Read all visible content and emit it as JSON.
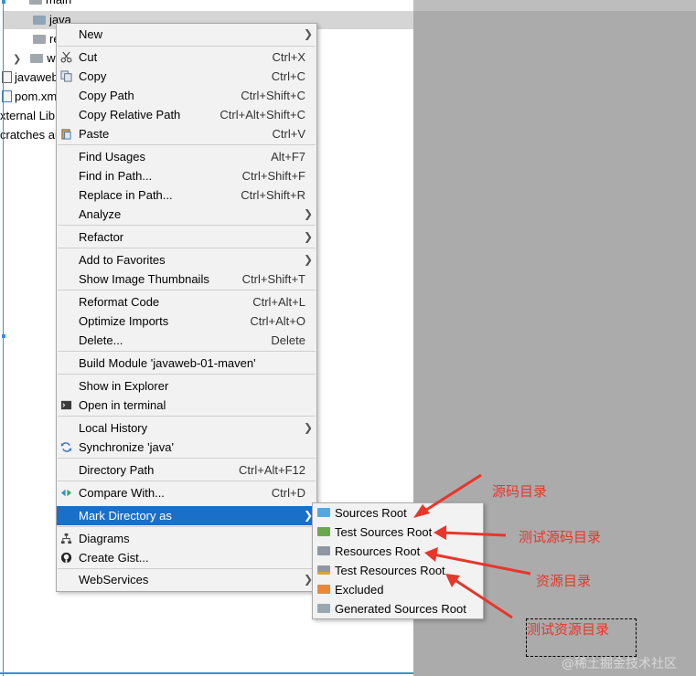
{
  "tree": {
    "main_label": "main",
    "java_label": "java",
    "res_label": "re",
    "w_label": "w",
    "javaweb_label": "javaweb",
    "pom_label": "pom.xm",
    "extlib_label": "xternal Lib",
    "scratches_label": "cratches ai"
  },
  "menu": {
    "new": {
      "label": "New"
    },
    "cut": {
      "label": "Cut",
      "shortcut": "Ctrl+X"
    },
    "copy": {
      "label": "Copy",
      "shortcut": "Ctrl+C"
    },
    "copy_path": {
      "label": "Copy Path",
      "shortcut": "Ctrl+Shift+C"
    },
    "copy_relative_path": {
      "label": "Copy Relative Path",
      "shortcut": "Ctrl+Alt+Shift+C"
    },
    "paste": {
      "label": "Paste",
      "shortcut": "Ctrl+V"
    },
    "find_usages": {
      "label": "Find Usages",
      "shortcut": "Alt+F7"
    },
    "find_in_path": {
      "label": "Find in Path...",
      "shortcut": "Ctrl+Shift+F"
    },
    "replace_in_path": {
      "label": "Replace in Path...",
      "shortcut": "Ctrl+Shift+R"
    },
    "analyze": {
      "label": "Analyze"
    },
    "refactor": {
      "label": "Refactor"
    },
    "add_to_favorites": {
      "label": "Add to Favorites"
    },
    "show_image_thumbnails": {
      "label": "Show Image Thumbnails",
      "shortcut": "Ctrl+Shift+T"
    },
    "reformat_code": {
      "label": "Reformat Code",
      "shortcut": "Ctrl+Alt+L"
    },
    "optimize_imports": {
      "label": "Optimize Imports",
      "shortcut": "Ctrl+Alt+O"
    },
    "delete": {
      "label": "Delete...",
      "shortcut": "Delete"
    },
    "build_module": {
      "label": "Build Module 'javaweb-01-maven'"
    },
    "show_in_explorer": {
      "label": "Show in Explorer"
    },
    "open_in_terminal": {
      "label": "Open in terminal"
    },
    "local_history": {
      "label": "Local History"
    },
    "synchronize": {
      "label": "Synchronize 'java'"
    },
    "directory_path": {
      "label": "Directory Path",
      "shortcut": "Ctrl+Alt+F12"
    },
    "compare_with": {
      "label": "Compare With...",
      "shortcut": "Ctrl+D"
    },
    "mark_directory_as": {
      "label": "Mark Directory as"
    },
    "diagrams": {
      "label": "Diagrams"
    },
    "create_gist": {
      "label": "Create Gist..."
    },
    "webservices": {
      "label": "WebServices"
    }
  },
  "submenu": {
    "sources_root": "Sources Root",
    "test_sources_root": "Test Sources Root",
    "resources_root": "Resources Root",
    "test_resources_root": "Test Resources Root",
    "excluded": "Excluded",
    "generated_sources_root": "Generated Sources Root"
  },
  "annotations": {
    "sources": "源码目录",
    "test_sources": "测试源码目录",
    "resources": "资源目录",
    "test_resources": "测试资源目录"
  },
  "watermark": "@稀土掘金技术社区",
  "icons": {
    "cut": "scissors-icon",
    "copy": "copy-icon",
    "paste": "paste-icon",
    "terminal": "terminal-icon",
    "sync": "sync-icon",
    "compare": "compare-icon",
    "diagrams": "diagram-icon",
    "gist": "github-icon"
  },
  "colors": {
    "highlight": "#1a6fc9",
    "annotation": "#e8362a",
    "sources_folder": "#5aa6d9",
    "test_sources_folder": "#6aa84f",
    "resources_folder": "#8d98a3",
    "excluded_folder": "#e8883a"
  }
}
